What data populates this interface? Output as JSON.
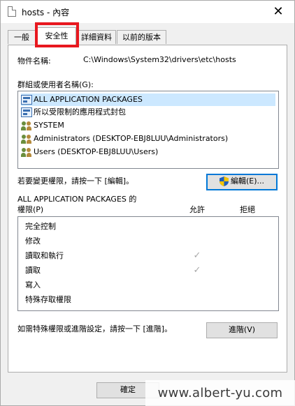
{
  "window": {
    "title": "hosts - 內容",
    "close_glyph": "✕"
  },
  "tabs": [
    {
      "label": "一般"
    },
    {
      "label": "安全性"
    },
    {
      "label": "詳細資料"
    },
    {
      "label": "以前的版本"
    }
  ],
  "security": {
    "object_label": "物件名稱:",
    "object_value": "C:\\Windows\\System32\\drivers\\etc\\hosts",
    "groups_label": "群組或使用者名稱(G):",
    "groups": [
      {
        "name": "ALL APPLICATION PACKAGES",
        "icon": "package-icon"
      },
      {
        "name": "所以受限制的應用程式封包",
        "icon": "package-icon"
      },
      {
        "name": "SYSTEM",
        "icon": "users-icon"
      },
      {
        "name": "Administrators (DESKTOP-EBJ8LUU\\Administrators)",
        "icon": "users-icon"
      },
      {
        "name": "Users (DESKTOP-EBJ8LUU\\Users)",
        "icon": "users-icon"
      }
    ],
    "edit_hint": "若要變更權限，請按一下 [編輯]。",
    "edit_button": "編輯(E)...",
    "perm_title_line1": "ALL APPLICATION PACKAGES 的",
    "perm_title_line2": "權限(P)",
    "allow_header": "允許",
    "deny_header": "拒絕",
    "permissions": [
      {
        "name": "完全控制",
        "allow": false,
        "deny": false
      },
      {
        "name": "修改",
        "allow": false,
        "deny": false
      },
      {
        "name": "讀取和執行",
        "allow": true,
        "deny": false
      },
      {
        "name": "讀取",
        "allow": true,
        "deny": false
      },
      {
        "name": "寫入",
        "allow": false,
        "deny": false
      },
      {
        "name": "特殊存取權限",
        "allow": false,
        "deny": false
      }
    ],
    "check_glyph": "✓",
    "advanced_hint": "如需特殊權限或進階設定，請按一下 [進階]。",
    "advanced_button": "進階(V)"
  },
  "footer": {
    "ok_button": "確定"
  },
  "watermark": "www.albert-yu.com",
  "colors": {
    "selection": "#cce8ff",
    "focus_border": "#0078d7",
    "highlight_box": "#e8181f"
  }
}
